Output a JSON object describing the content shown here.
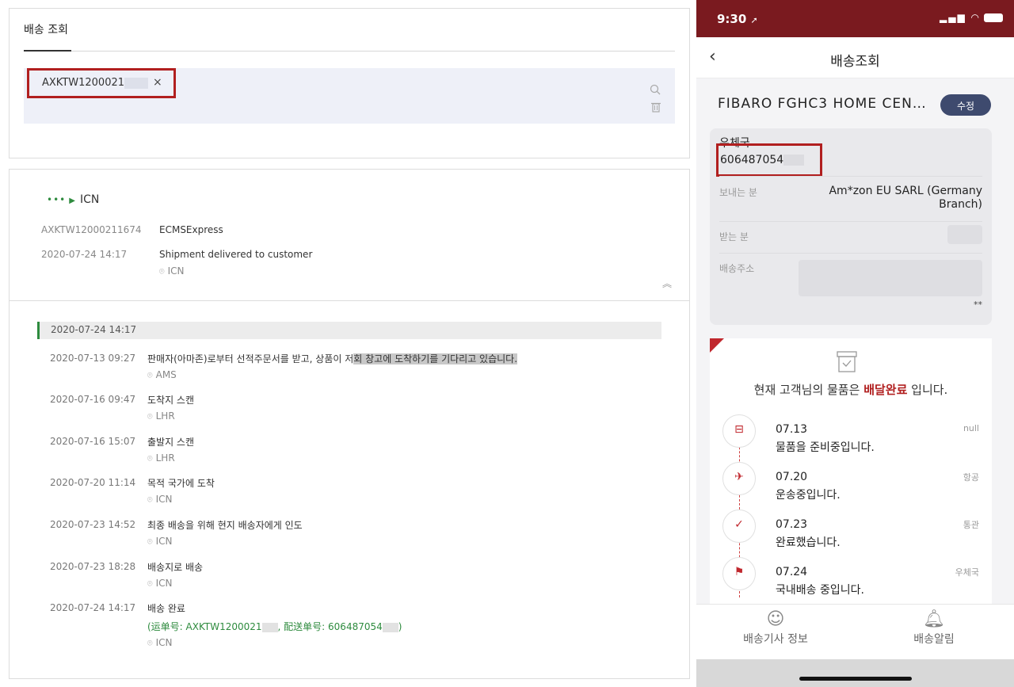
{
  "web": {
    "tab_title": "배송 조회",
    "search_chip_text": "AXKTW1200021",
    "chip_close": "×",
    "route": "ICN",
    "summary": {
      "tracking_no": "AXKTW12000211674",
      "carrier": "ECMSExpress",
      "datetime": "2020-07-24 14:17",
      "status": "Shipment delivered to customer",
      "location": "ICN"
    },
    "latest_date": "2020-07-24 14:17",
    "events": [
      {
        "time": "2020-07-13 09:27",
        "desc_a": "판매자(아마존)로부터 선적주문서를 받고, 상품이 저",
        "desc_b": "회 창고에 도착하기를 기다리고 있습니다.",
        "loc": "AMS"
      },
      {
        "time": "2020-07-16 09:47",
        "desc_a": "도착지 스캔",
        "desc_b": "",
        "loc": "LHR"
      },
      {
        "time": "2020-07-16 15:07",
        "desc_a": "출발지 스캔",
        "desc_b": "",
        "loc": "LHR"
      },
      {
        "time": "2020-07-20 11:14",
        "desc_a": "목적 국가에 도착",
        "desc_b": "",
        "loc": "ICN"
      },
      {
        "time": "2020-07-23 14:52",
        "desc_a": "최종 배송을 위해 현지 배송자에게 인도",
        "desc_b": "",
        "loc": "ICN"
      },
      {
        "time": "2020-07-23 18:28",
        "desc_a": "배송지로 배송",
        "desc_b": "",
        "loc": "ICN"
      },
      {
        "time": "2020-07-24 14:17",
        "desc_a": "배송 완료",
        "desc_b": "",
        "loc": "ICN"
      }
    ],
    "final_extra_a": "(运单号: AXKTW1200021",
    "final_extra_b": ", 配送单号: 606487054",
    "final_extra_c": ")"
  },
  "phone": {
    "status_time": "9:30",
    "nav_title": "배송조회",
    "product_name": "FIBARO FGHC3 HOME CEN…",
    "edit_label": "수정",
    "post_label": "우체국",
    "post_number": "606487054",
    "sender_label": "보내는 분",
    "sender_value": "Am*zon EU SARL (Germany Branch)",
    "receiver_label": "받는 분",
    "address_label": "배송주소",
    "address_suffix": "**",
    "delivery_msg_a": "현재 고객님의 물품은 ",
    "delivery_msg_b": "배달완료",
    "delivery_msg_c": " 입니다.",
    "steps": [
      {
        "date": "07.13",
        "text": "물품을 준비중입니다.",
        "tag": "null",
        "icon": "cart-icon"
      },
      {
        "date": "07.20",
        "text": "운송중입니다.",
        "tag": "항공",
        "icon": "airplane-icon"
      },
      {
        "date": "07.23",
        "text": "완료했습니다.",
        "tag": "통관",
        "icon": "check-icon"
      },
      {
        "date": "07.24",
        "text": "국내배송 중입니다.",
        "tag": "우체국",
        "icon": "delivery-cart-icon"
      }
    ],
    "tab_driver": "배송기사 정보",
    "tab_alert": "배송알림"
  },
  "colors": {
    "accent_red": "#b11f1f",
    "status_bar": "#7a1a1f",
    "green": "#2e8b3e",
    "edit_button": "#3e4a6e"
  }
}
